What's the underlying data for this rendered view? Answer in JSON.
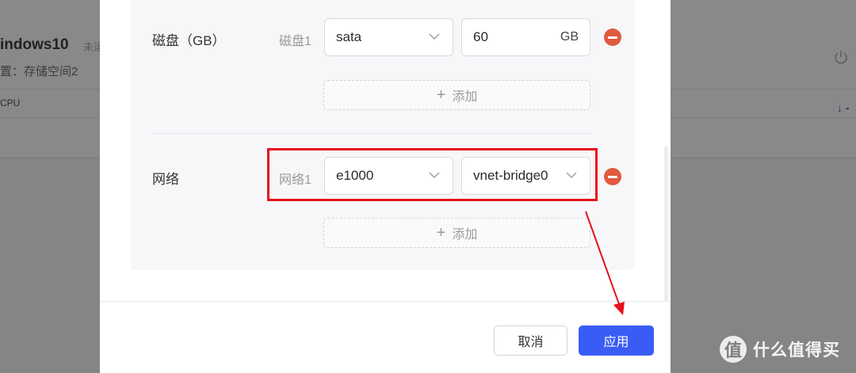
{
  "background": {
    "vm_title": "indows10",
    "badge": "未运",
    "subtitle": "置：存储空间2",
    "cpu_label": "CPU",
    "arrow_glyph": "↓ -"
  },
  "modal": {
    "disk": {
      "row_label": "磁盘（GB）",
      "field_label": "磁盘1",
      "bus_value": "sata",
      "size_value": "60",
      "size_unit": "GB",
      "add_label": "添加"
    },
    "network": {
      "row_label": "网络",
      "field_label": "网络1",
      "adapter_value": "e1000",
      "bridge_value": "vnet-bridge0",
      "add_label": "添加"
    },
    "footer": {
      "cancel_label": "取消",
      "apply_label": "应用"
    }
  },
  "watermark": {
    "logo_glyph": "值",
    "text": "什么值得买"
  },
  "colors": {
    "accent": "#3a5cf5",
    "remove": "#e05a3f",
    "highlight": "#e8101a"
  }
}
